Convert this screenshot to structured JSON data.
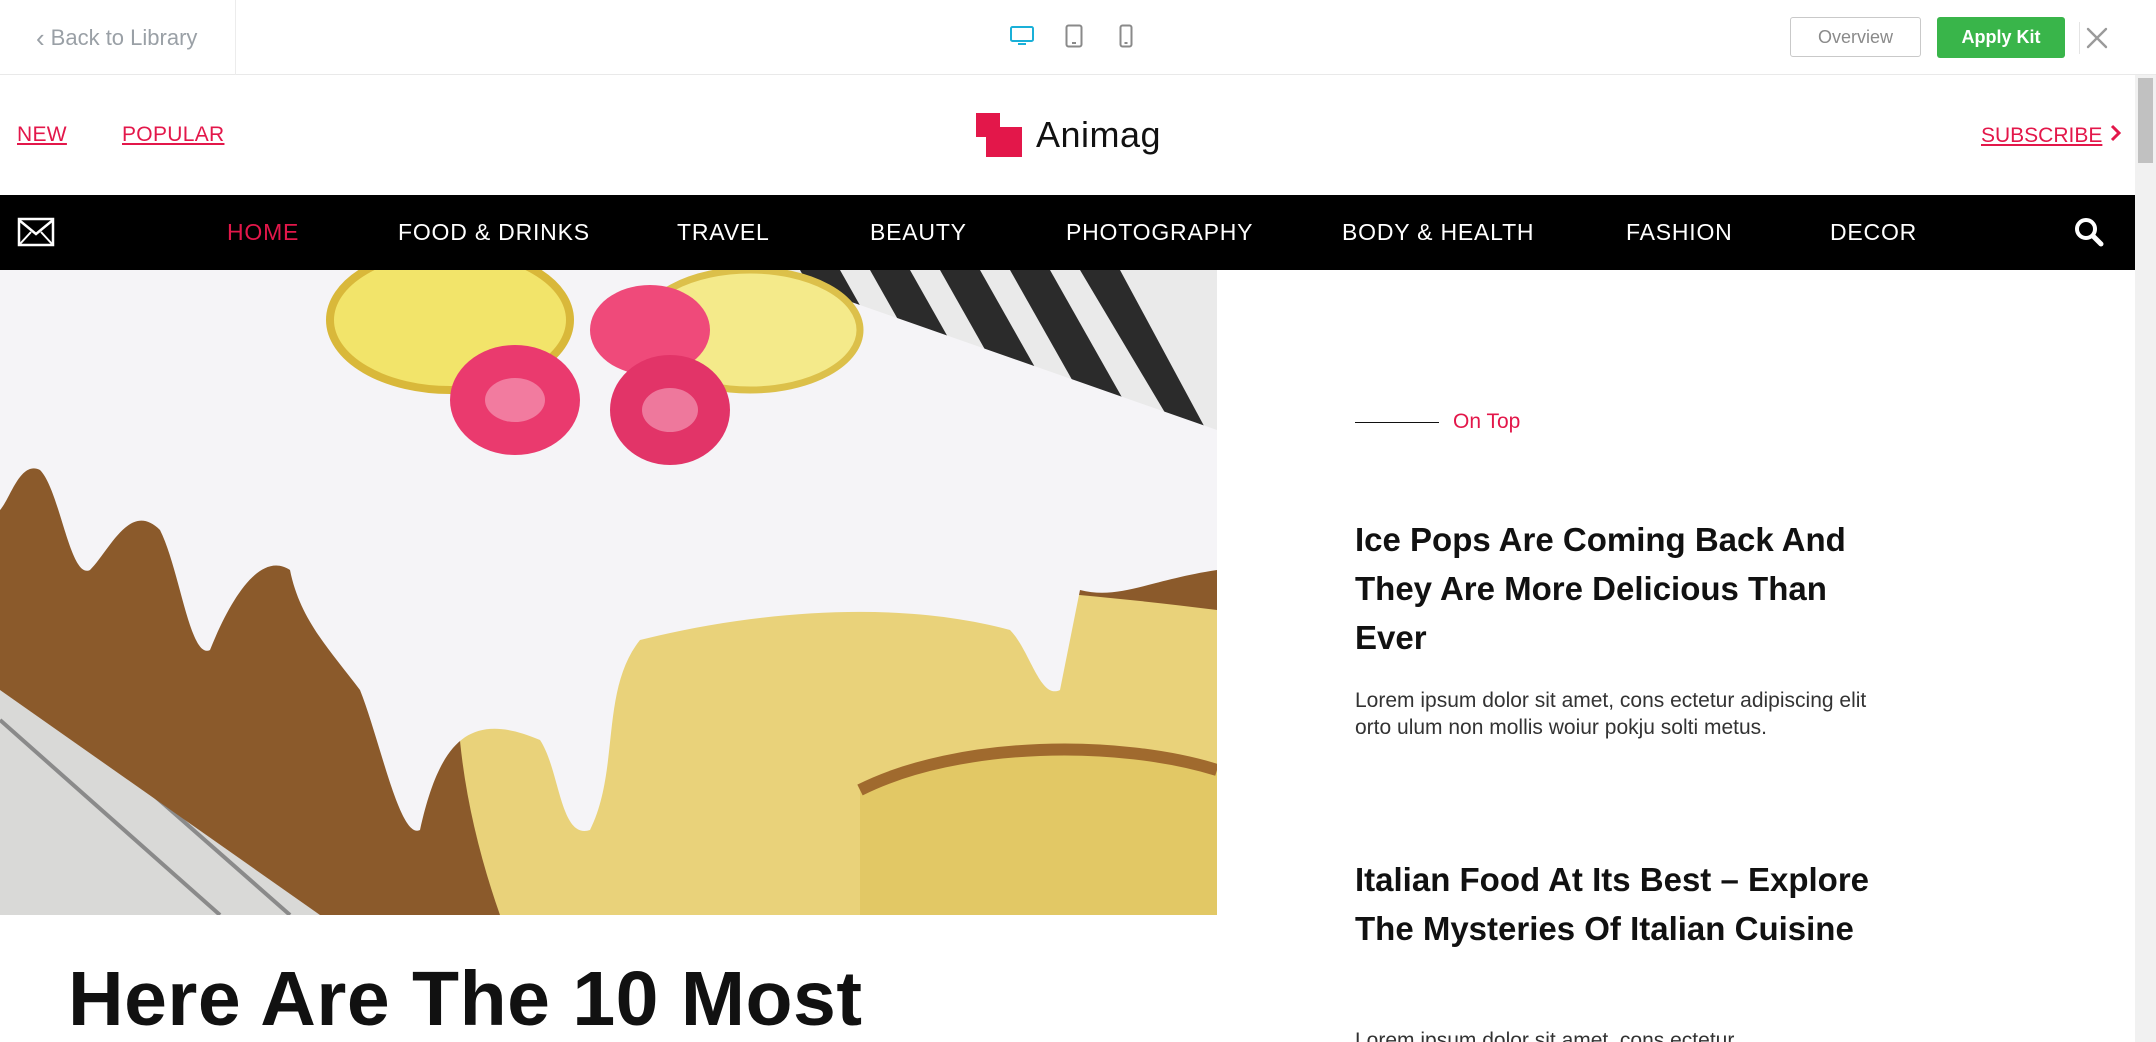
{
  "editor": {
    "back_label": "Back to Library",
    "overview_label": "Overview",
    "apply_label": "Apply Kit",
    "devices": [
      "desktop-icon",
      "tablet-icon",
      "mobile-icon"
    ],
    "active_device_color": "#1ab0d8",
    "apply_color": "#39b54a"
  },
  "site": {
    "header": {
      "links": [
        "NEW",
        "POPULAR"
      ],
      "logo_text": "Animag",
      "subscribe_label": "SUBSCRIBE",
      "brand_color": "#e3174a"
    },
    "nav": {
      "items": [
        "HOME",
        "FOOD & DRINKS",
        "TRAVEL",
        "BEAUTY",
        "PHOTOGRAPHY",
        "BODY & HEALTH",
        "FASHION",
        "DECOR"
      ],
      "active_index": 0
    },
    "hero": {
      "headline": "Here Are The 10 Most"
    },
    "sidebar": {
      "section_label": "On Top",
      "articles": [
        {
          "title": "Ice Pops Are Coming Back And They Are More Delicious Than Ever",
          "excerpt": "Lorem ipsum dolor sit amet, cons ectetur adipiscing elit orto ulum non mollis woiur pokju solti metus."
        },
        {
          "title": "Italian Food At Its Best – Explore The Mysteries Of Italian Cuisine",
          "excerpt": "Lorem ipsum dolor sit amet, cons ectetur"
        }
      ]
    }
  }
}
